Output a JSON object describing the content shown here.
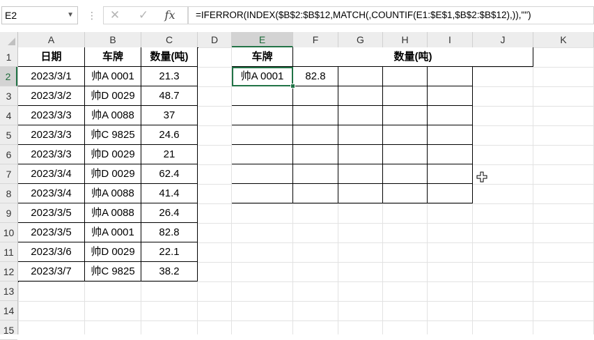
{
  "formula_bar": {
    "name_box": "E2",
    "formula": "=IFERROR(INDEX($B$2:$B$12,MATCH(,COUNTIF(E1:$E$1,$B$2:$B$12),)),\"\")",
    "cancel_icon": "close-icon",
    "enter_icon": "check-icon",
    "function_icon": "fx-icon",
    "fx_label": "fx"
  },
  "columns": [
    "A",
    "B",
    "C",
    "D",
    "E",
    "F",
    "G",
    "H",
    "I",
    "J",
    "K"
  ],
  "rows": [
    "1",
    "2",
    "3",
    "4",
    "5",
    "6",
    "7",
    "8",
    "9",
    "10",
    "11",
    "12",
    "13",
    "14",
    "15"
  ],
  "active_cell": "E2",
  "source_table": {
    "headers": [
      "日期",
      "车牌",
      "数量(吨)"
    ],
    "rows": [
      [
        "2023/3/1",
        "帅A 0001",
        "21.3"
      ],
      [
        "2023/3/2",
        "帅D 0029",
        "48.7"
      ],
      [
        "2023/3/3",
        "帅A 0088",
        "37"
      ],
      [
        "2023/3/3",
        "帅C 9825",
        "24.6"
      ],
      [
        "2023/3/3",
        "帅D 0029",
        "21"
      ],
      [
        "2023/3/4",
        "帅D 0029",
        "62.4"
      ],
      [
        "2023/3/4",
        "帅A 0088",
        "41.4"
      ],
      [
        "2023/3/5",
        "帅A 0088",
        "26.4"
      ],
      [
        "2023/3/5",
        "帅A 0001",
        "82.8"
      ],
      [
        "2023/3/6",
        "帅D 0029",
        "22.1"
      ],
      [
        "2023/3/7",
        "帅C 9825",
        "38.2"
      ]
    ]
  },
  "result_table": {
    "header_plate": "车牌",
    "header_qty": "数量(吨)",
    "rows": [
      [
        "帅A 0001",
        "82.8",
        "",
        "",
        ""
      ],
      [
        "",
        "",
        "",
        "",
        ""
      ],
      [
        "",
        "",
        "",
        "",
        ""
      ],
      [
        "",
        "",
        "",
        "",
        ""
      ],
      [
        "",
        "",
        "",
        "",
        ""
      ],
      [
        "",
        "",
        "",
        "",
        ""
      ],
      [
        "",
        "",
        "",
        "",
        ""
      ]
    ]
  }
}
